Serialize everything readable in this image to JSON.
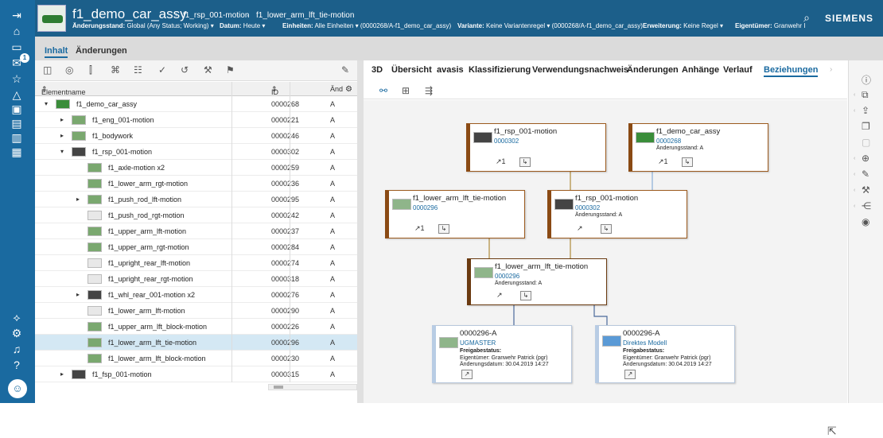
{
  "header": {
    "title": "f1_demo_car_assy",
    "crumb1": "f1_rsp_001-motion",
    "crumb2": "f1_lower_arm_lft_tie-motion",
    "aenderungsstand_label": "Änderungsstand:",
    "aenderungsstand_value": "Global (Any Status; Working) ▾",
    "datum_label": "Datum:",
    "datum_value": "Heute ▾",
    "einheiten_label": "Einheiten:",
    "einheiten_value": "Alle Einheiten ▾ (0000268/A-f1_demo_car_assy)",
    "variante_label": "Variante:",
    "variante_value": "Keine Variantenregel ▾ (0000268/A-f1_demo_car_assy)",
    "erweiterung_label": "Erweiterung:",
    "erweiterung_value": "Keine Regel ▾",
    "eigentuemer_label": "Eigentümer:",
    "eigentuemer_value": "Granwehr I",
    "brand": "SIEMENS",
    "badge": "1"
  },
  "tabs": {
    "inhalt": "Inhalt",
    "aenderungen": "Änderungen"
  },
  "tree": {
    "col_name": "Elementname",
    "col_id": "ID",
    "col_rev": "Änd",
    "rows": [
      {
        "name": "f1_demo_car_assy",
        "id": "0000268",
        "rev": "A"
      },
      {
        "name": "f1_eng_001-motion",
        "id": "0000221",
        "rev": "A"
      },
      {
        "name": "f1_bodywork",
        "id": "0000246",
        "rev": "A"
      },
      {
        "name": "f1_rsp_001-motion",
        "id": "0000302",
        "rev": "A"
      },
      {
        "name": "f1_axle-motion x2",
        "id": "0000259",
        "rev": "A"
      },
      {
        "name": "f1_lower_arm_rgt-motion",
        "id": "0000236",
        "rev": "A"
      },
      {
        "name": "f1_push_rod_lft-motion",
        "id": "0000295",
        "rev": "A"
      },
      {
        "name": "f1_push_rod_rgt-motion",
        "id": "0000242",
        "rev": "A"
      },
      {
        "name": "f1_upper_arm_lft-motion",
        "id": "0000237",
        "rev": "A"
      },
      {
        "name": "f1_upper_arm_rgt-motion",
        "id": "0000284",
        "rev": "A"
      },
      {
        "name": "f1_upright_rear_lft-motion",
        "id": "0000274",
        "rev": "A"
      },
      {
        "name": "f1_upright_rear_rgt-motion",
        "id": "0000318",
        "rev": "A"
      },
      {
        "name": "f1_whl_rear_001-motion x2",
        "id": "0000276",
        "rev": "A"
      },
      {
        "name": "f1_lower_arm_lft-motion",
        "id": "0000290",
        "rev": "A"
      },
      {
        "name": "f1_upper_arm_lft_block-motion",
        "id": "0000226",
        "rev": "A"
      },
      {
        "name": "f1_lower_arm_lft_tie-motion",
        "id": "0000296",
        "rev": "A"
      },
      {
        "name": "f1_lower_arm_lft_block-motion",
        "id": "0000230",
        "rev": "A"
      },
      {
        "name": "f1_fsp_001-motion",
        "id": "0000315",
        "rev": "A"
      }
    ]
  },
  "right_tabs": [
    "3D",
    "Übersicht",
    "avasis",
    "Klassifizierung",
    "Verwendungsnachweis",
    "Änderungen",
    "Anhänge",
    "Verlauf",
    "Beziehungen"
  ],
  "nodes": {
    "n1": {
      "title": "f1_rsp_001-motion",
      "id": "0000302"
    },
    "n2": {
      "title": "f1_demo_car_assy",
      "id": "0000268",
      "rev": "Änderungsstand: A"
    },
    "n3": {
      "title": "f1_lower_arm_lft_tie-motion",
      "id": "0000296"
    },
    "n4": {
      "title": "f1_rsp_001-motion",
      "id": "0000302",
      "rev": "Änderungsstand: A"
    },
    "n5": {
      "title": "f1_lower_arm_lft_tie-motion",
      "id": "0000296",
      "rev": "Änderungsstand: A"
    },
    "d1": {
      "title": "0000296-A",
      "sub": "UGMASTER",
      "l1": "Freigabestatus:",
      "l2": "Eigentümer: Granwehr Patrick (pgr)",
      "l3": "Änderungsdatum: 30.04.2019 14:27"
    },
    "d2": {
      "title": "0000296-A",
      "sub": "Direktes Modell",
      "l1": "Freigabestatus:",
      "l2": "Eigentümer: Granwehr Patrick (pgr)",
      "l3": "Änderungsdatum: 30.04.2019 14:27"
    }
  }
}
